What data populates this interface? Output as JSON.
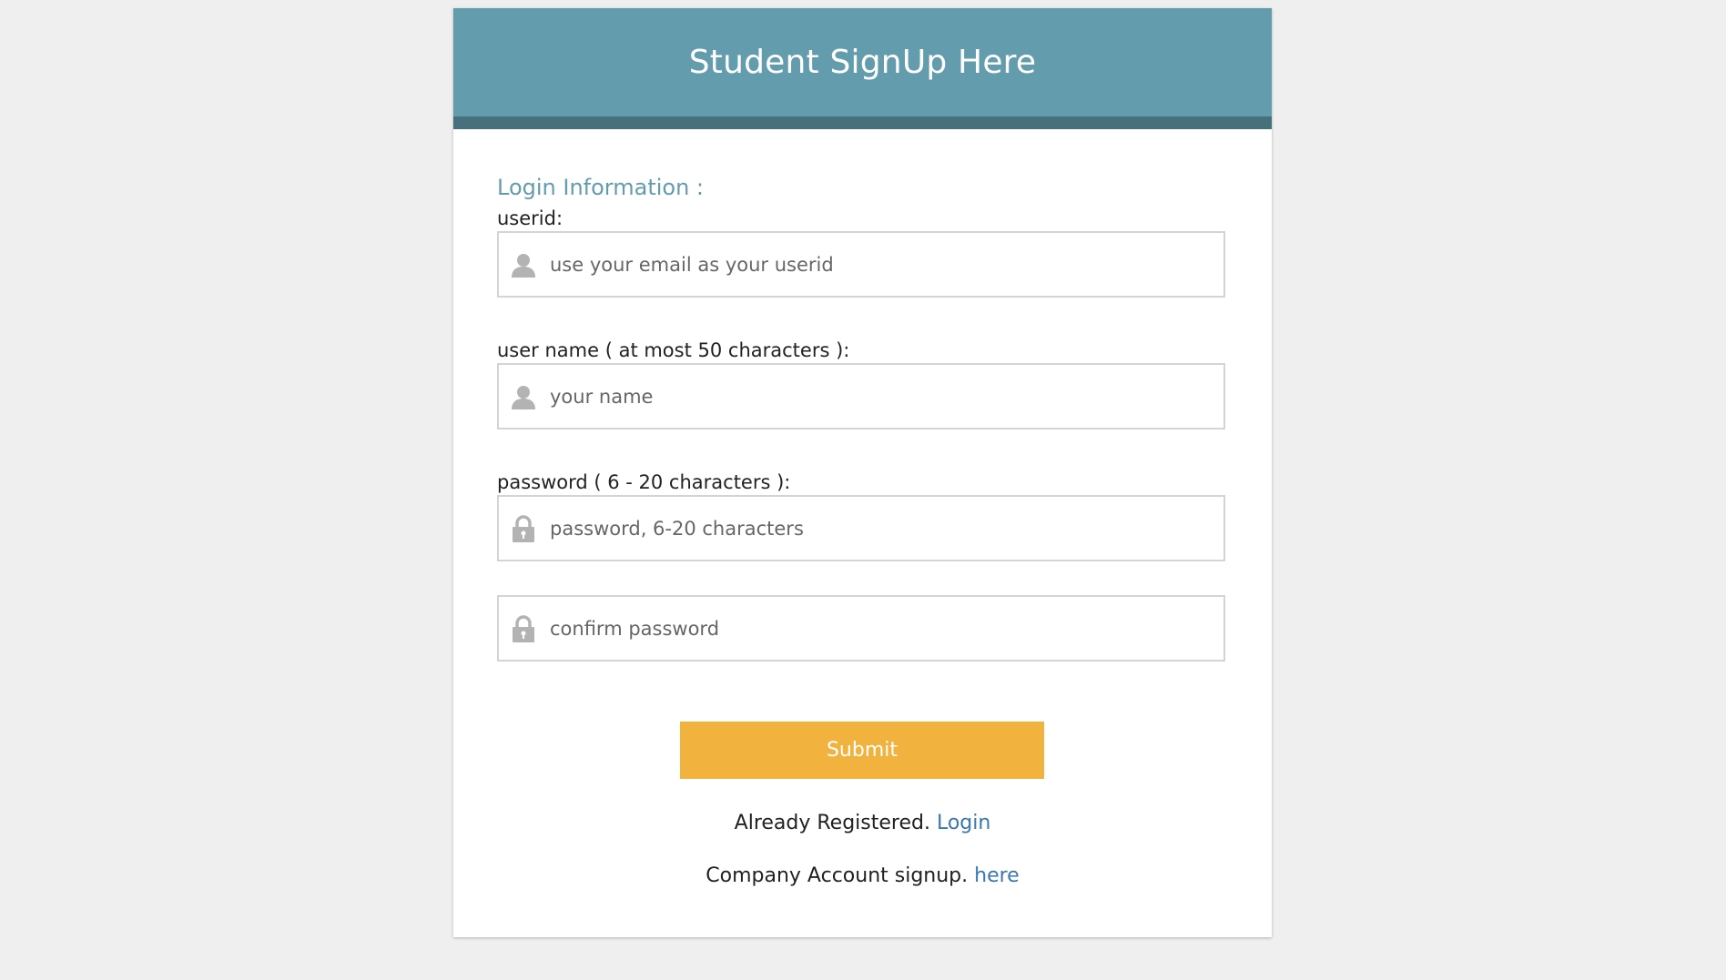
{
  "header": {
    "title": "Student SignUp Here"
  },
  "form": {
    "section_title": "Login Information :",
    "userid": {
      "label": "userid:",
      "placeholder": "use your email as your userid",
      "value": "",
      "icon": "user-icon"
    },
    "username": {
      "label": "user name ( at most 50 characters ):",
      "placeholder": "your name",
      "value": "",
      "icon": "user-icon"
    },
    "password": {
      "label": "password ( 6 - 20 characters ):",
      "placeholder": "password, 6-20 characters",
      "value": "",
      "icon": "lock-icon"
    },
    "confirm_password": {
      "placeholder": "confirm password",
      "value": "",
      "icon": "lock-icon"
    },
    "submit_label": "Submit"
  },
  "footer": {
    "registered_text": "Already Registered.",
    "login_link": "Login",
    "company_text": "Company Account signup.",
    "company_link": "here"
  },
  "colors": {
    "header_bg": "#639cad",
    "header_border": "#46707b",
    "accent_text": "#639cad",
    "submit_bg": "#f2b23e",
    "link": "#3a76b0",
    "page_bg": "#efefef"
  }
}
